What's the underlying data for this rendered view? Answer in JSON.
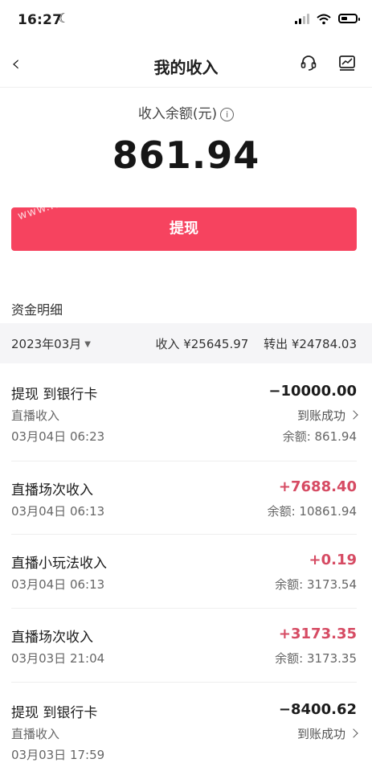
{
  "status_bar": {
    "time": "16:27"
  },
  "nav": {
    "back": "‹",
    "title": "我的收入"
  },
  "balance": {
    "label": "收入余额(元)",
    "info_icon": "i",
    "amount": "861.94"
  },
  "withdraw_button": {
    "label": "提现",
    "watermark": "www.idm.org.cn"
  },
  "details": {
    "title": "资金明细",
    "month": "2023年03月",
    "income": "收入 ¥25645.97",
    "outgoing": "转出 ¥24784.03"
  },
  "transactions": [
    {
      "title": "提现  到银行卡",
      "sub": "直播收入",
      "time": "03月04日 06:23",
      "amount": "−10000.00",
      "status": "到账成功",
      "balance": "余额: 861.94",
      "positive": false
    },
    {
      "title": "直播场次收入",
      "time": "03月04日 06:13",
      "amount": "+7688.40",
      "balance": "余额: 10861.94",
      "positive": true
    },
    {
      "title": "直播小玩法收入",
      "time": "03月04日 06:13",
      "amount": "+0.19",
      "balance": "余额: 3173.54",
      "positive": true
    },
    {
      "title": "直播场次收入",
      "time": "03月03日 21:04",
      "amount": "+3173.35",
      "balance": "余额: 3173.35",
      "positive": true
    },
    {
      "title": "提现  到银行卡",
      "sub": "直播收入",
      "time": "03月03日 17:59",
      "amount": "−8400.62",
      "status": "到账成功",
      "positive": false
    }
  ]
}
